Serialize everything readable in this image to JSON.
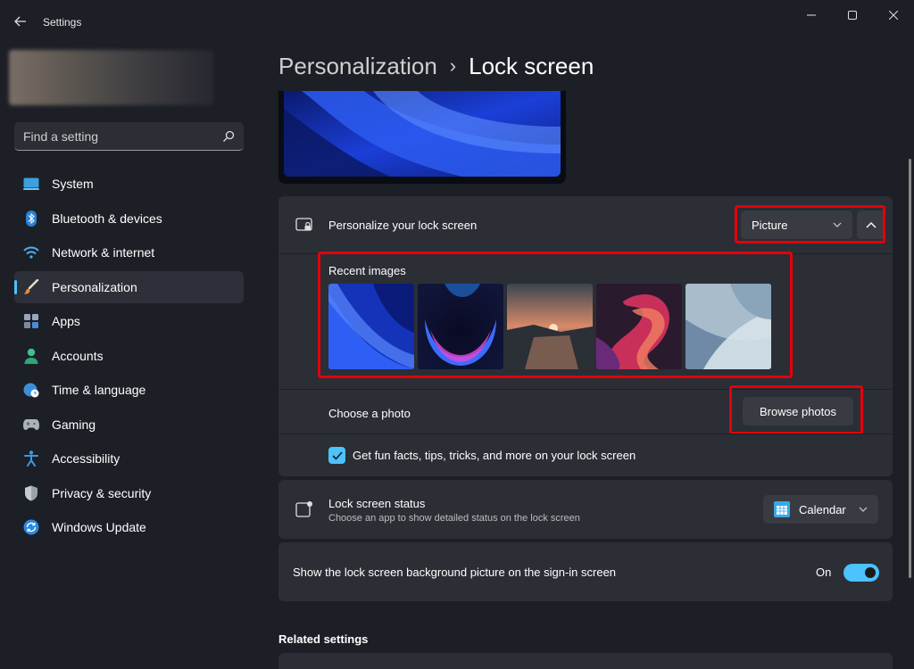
{
  "window": {
    "title": "Settings",
    "controls": {
      "minimize": "minimize-icon",
      "maximize": "maximize-icon",
      "close": "close-icon"
    }
  },
  "search": {
    "placeholder": "Find a setting"
  },
  "sidebar": {
    "items": [
      {
        "label": "System",
        "icon": "system-icon",
        "active": false
      },
      {
        "label": "Bluetooth & devices",
        "icon": "bluetooth-icon",
        "active": false
      },
      {
        "label": "Network & internet",
        "icon": "wifi-icon",
        "active": false
      },
      {
        "label": "Personalization",
        "icon": "brush-icon",
        "active": true
      },
      {
        "label": "Apps",
        "icon": "apps-icon",
        "active": false
      },
      {
        "label": "Accounts",
        "icon": "person-icon",
        "active": false
      },
      {
        "label": "Time & language",
        "icon": "clock-globe-icon",
        "active": false
      },
      {
        "label": "Gaming",
        "icon": "gamepad-icon",
        "active": false
      },
      {
        "label": "Accessibility",
        "icon": "accessibility-icon",
        "active": false
      },
      {
        "label": "Privacy & security",
        "icon": "shield-icon",
        "active": false
      },
      {
        "label": "Windows Update",
        "icon": "update-icon",
        "active": false
      }
    ]
  },
  "breadcrumb": {
    "parent": "Personalization",
    "separator": "›",
    "current": "Lock screen"
  },
  "personalize": {
    "title": "Personalize your lock screen",
    "dropdown_value": "Picture",
    "recent_label": "Recent images",
    "recent_images": [
      "bloom-blue",
      "bloom-ring",
      "sunset-lake",
      "ribbon-purple",
      "bloom-light"
    ],
    "choose_label": "Choose a photo",
    "browse_label": "Browse photos",
    "fun_facts_label": "Get fun facts, tips, tricks, and more on your lock screen",
    "fun_facts_checked": true
  },
  "status": {
    "title": "Lock screen status",
    "subtitle": "Choose an app to show detailed status on the lock screen",
    "dropdown_value": "Calendar"
  },
  "signin": {
    "label": "Show the lock screen background picture on the sign-in screen",
    "toggle_label": "On",
    "toggle_on": true
  },
  "related": {
    "title": "Related settings"
  },
  "colors": {
    "accent": "#4cc2ff",
    "highlight": "#e3000b",
    "card": "#2b2e35",
    "background": "#1c1f26"
  }
}
